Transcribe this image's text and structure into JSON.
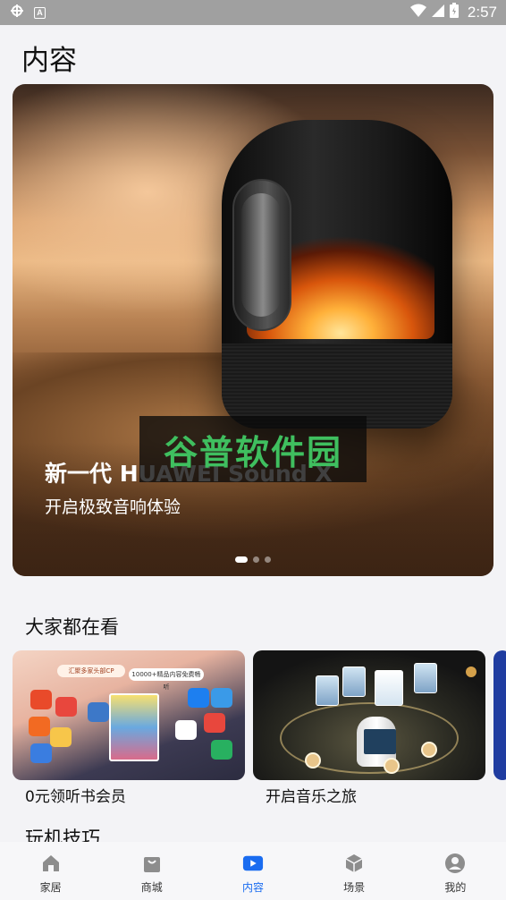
{
  "status_bar": {
    "time": "2:57",
    "left_icons": [
      "bug-icon",
      "a-box-icon"
    ],
    "right_icons": [
      "wifi-icon",
      "signal-icon",
      "battery-icon"
    ]
  },
  "page": {
    "title": "内容"
  },
  "hero": {
    "title": "新一代 HUAWEI Sound X",
    "subtitle": "开启极致音响体验",
    "watermark": "谷普软件园",
    "dots": {
      "count": 3,
      "active_index": 0
    }
  },
  "section_popular": {
    "title": "大家都在看",
    "cards": [
      {
        "caption": "0元领听书会员",
        "banner_left": "汇聚多家头部CP",
        "banner_right": "10000+精品内容免费畅听"
      },
      {
        "caption": "开启音乐之旅"
      },
      {
        "caption": ""
      }
    ]
  },
  "section_tips": {
    "title": "玩机技巧"
  },
  "bottom_nav": {
    "active_color": "#1a6cf0",
    "items": [
      {
        "label": "家居",
        "icon": "home-icon"
      },
      {
        "label": "商城",
        "icon": "shopping-bag-icon"
      },
      {
        "label": "内容",
        "icon": "play-icon",
        "active": true
      },
      {
        "label": "场景",
        "icon": "cube-icon"
      },
      {
        "label": "我的",
        "icon": "person-icon"
      }
    ]
  }
}
